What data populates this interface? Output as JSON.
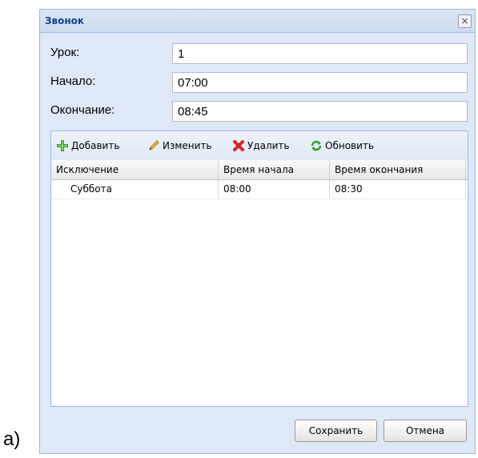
{
  "caption": "a)",
  "dialog": {
    "title": "Звонок",
    "close_symbol": "×",
    "fields": {
      "lesson_label": "Урок:",
      "lesson_value": "1",
      "start_label": "Начало:",
      "start_value": "07:00",
      "end_label": "Окончание:",
      "end_value": "08:45"
    },
    "toolbar": {
      "add": "Добавить",
      "edit": "Изменить",
      "delete": "Удалить",
      "refresh": "Обновить"
    },
    "grid": {
      "columns": [
        "Исключение",
        "Время начала",
        "Время окончания"
      ],
      "rows": [
        [
          "Суббота",
          "08:00",
          "08:30"
        ]
      ]
    },
    "buttons": {
      "save": "Сохранить",
      "cancel": "Отмена"
    }
  },
  "icons": {
    "add": "plus-icon",
    "edit": "pencil-icon",
    "delete": "red-x-icon",
    "refresh": "refresh-icon"
  }
}
